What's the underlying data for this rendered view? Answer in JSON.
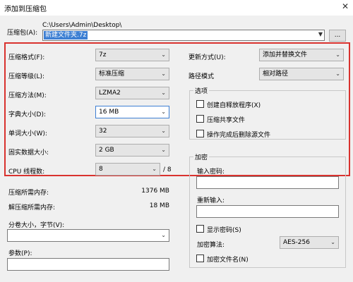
{
  "window": {
    "title": "添加到压缩包",
    "close_icon": "close-icon"
  },
  "archive": {
    "label": "压缩包(A):",
    "path": "C:\\Users\\Admin\\Desktop\\",
    "filename": "新建文件夹.7z",
    "browse_label": "..."
  },
  "left_fields": [
    {
      "label": "压缩格式(F):",
      "value": "7z"
    },
    {
      "label": "压缩等级(L):",
      "value": "标准压缩"
    },
    {
      "label": "压缩方法(M):",
      "value": "LZMA2"
    },
    {
      "label": "字典大小(D):",
      "value": "16 MB"
    },
    {
      "label": "单词大小(W):",
      "value": "32"
    },
    {
      "label": "固实数据大小:",
      "value": "2 GB"
    }
  ],
  "cpu": {
    "label": "CPU 线程数:",
    "value": "8",
    "total": "/ 8"
  },
  "memory": {
    "compress_label": "压缩所需内存:",
    "compress_value": "1376 MB",
    "decompress_label": "解压缩所需内存:",
    "decompress_value": "18 MB"
  },
  "split": {
    "label": "分卷大小，字节(V):",
    "value": ""
  },
  "params": {
    "label": "参数(P):",
    "value": ""
  },
  "update_mode": {
    "label": "更新方式(U):",
    "value": "添加并替换文件"
  },
  "path_mode": {
    "label": "路径模式",
    "value": "相对路径"
  },
  "options": {
    "title": "选项",
    "items": [
      {
        "label": "创建自释放程序(X)",
        "checked": false
      },
      {
        "label": "压缩共享文件",
        "checked": false
      },
      {
        "label": "操作完成后删除源文件",
        "checked": false
      }
    ]
  },
  "encryption": {
    "title": "加密",
    "password_label": "输入密码:",
    "reenter_label": "重新输入:",
    "show_password_label": "显示密码(S)",
    "show_password_checked": false,
    "method_label": "加密算法:",
    "method_value": "AES-256",
    "encrypt_names_label": "加密文件名(N)",
    "encrypt_names_checked": false
  }
}
